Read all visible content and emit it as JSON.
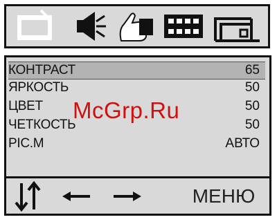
{
  "icon_bar": {
    "icons": [
      "picture-icon",
      "sound-icon",
      "function-icon",
      "channel-icon",
      "setup-icon"
    ],
    "selected": "picture-icon"
  },
  "menu": {
    "items": [
      {
        "label": "КОНТРАСТ",
        "value": "65"
      },
      {
        "label": "ЯРКОСТЬ",
        "value": "50"
      },
      {
        "label": "ЦВЕТ",
        "value": "50"
      },
      {
        "label": "ЧЕТКОСТЬ",
        "value": "50"
      },
      {
        "label": "PIC.M",
        "value": "АВТО"
      }
    ],
    "selected_index": 0
  },
  "footer": {
    "icons": [
      "up-down-arrows-icon",
      "left-arrow-icon",
      "right-arrow-icon"
    ],
    "menu_label": "МЕНЮ"
  },
  "watermark": "McGrp.Ru"
}
